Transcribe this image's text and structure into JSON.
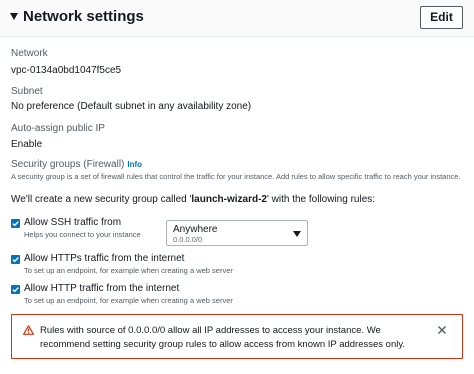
{
  "header": {
    "title": "Network settings",
    "edit_label": "Edit"
  },
  "fields": {
    "network_label": "Network",
    "network_value": "vpc-0134a0bd1047f5ce5",
    "subnet_label": "Subnet",
    "subnet_value": "No preference (Default subnet in any availability zone)",
    "public_ip_label": "Auto-assign public IP",
    "public_ip_value": "Enable"
  },
  "security": {
    "label": "Security groups (Firewall)",
    "info": "Info",
    "description": "A security group is a set of firewall rules that control the traffic for your instance. Add rules to allow specific traffic to reach your instance.",
    "create_prefix": "We'll create a new security group called '",
    "group_name": "launch-wizard-2",
    "create_suffix": "' with the following rules:"
  },
  "rules": [
    {
      "label": "Allow SSH traffic from",
      "sub": "Helps you connect to your instance",
      "checked": true
    },
    {
      "label": "Allow HTTPs traffic from the internet",
      "sub": "To set up an endpoint, for example when creating a web server",
      "checked": true
    },
    {
      "label": "Allow HTTP traffic from the internet",
      "sub": "To set up an endpoint, for example when creating a web server",
      "checked": true
    }
  ],
  "ssh_source": {
    "value": "Anywhere",
    "sub": "0.0.0.0/0"
  },
  "alert": {
    "text": "Rules with source of 0.0.0.0/0 allow all IP addresses to access your instance. We recommend setting security group rules to allow access from known IP addresses only."
  },
  "colors": {
    "accent": "#0073bb",
    "warning_border": "#d13212"
  }
}
